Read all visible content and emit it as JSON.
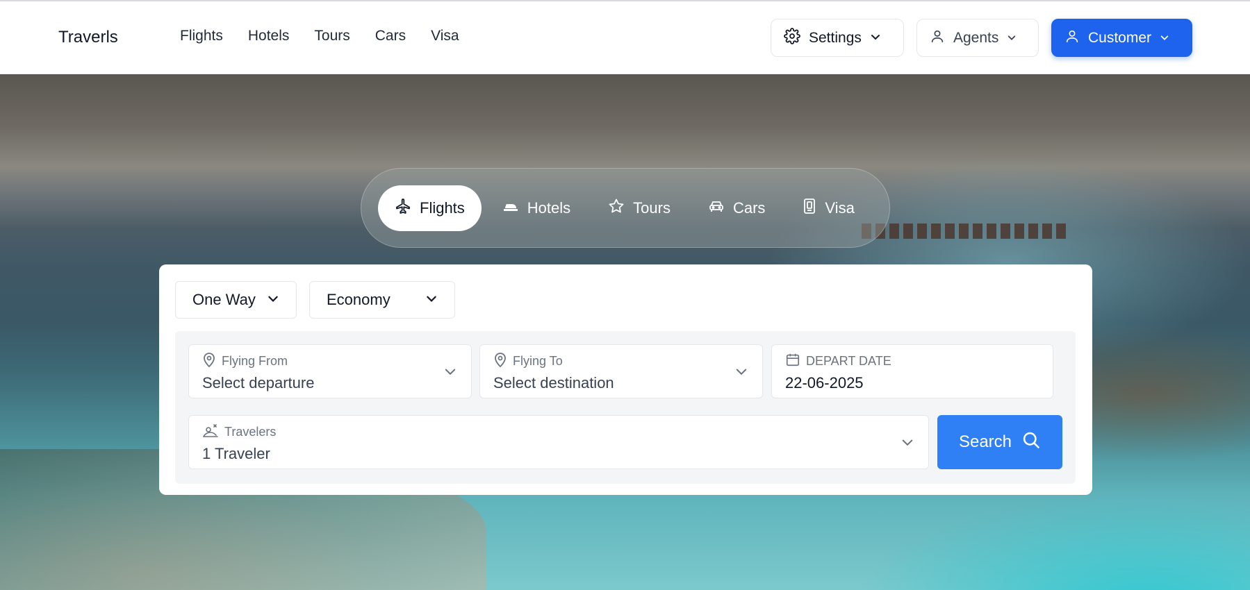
{
  "header": {
    "brand": "Traverls",
    "nav": [
      "Flights",
      "Hotels",
      "Tours",
      "Cars",
      "Visa"
    ],
    "settings_label": "Settings",
    "agents_label": "Agents",
    "customer_label": "Customer",
    "accent_color": "#1d63ed"
  },
  "categories": [
    {
      "label": "Flights",
      "icon": "plane-icon",
      "active": true
    },
    {
      "label": "Hotels",
      "icon": "hotel-icon",
      "active": false
    },
    {
      "label": "Tours",
      "icon": "star-icon",
      "active": false
    },
    {
      "label": "Cars",
      "icon": "car-icon",
      "active": false
    },
    {
      "label": "Visa",
      "icon": "passport-icon",
      "active": false
    }
  ],
  "search": {
    "trip_type": "One Way",
    "cabin_class": "Economy",
    "from_label": "Flying From",
    "from_value": "Select departure",
    "to_label": "Flying To",
    "to_value": "Select destination",
    "date_label": "DEPART DATE",
    "date_value": "22-06-2025",
    "travelers_label": "Travelers",
    "travelers_value": "1 Traveler",
    "search_label": "Search",
    "search_color": "#2f80f5"
  }
}
